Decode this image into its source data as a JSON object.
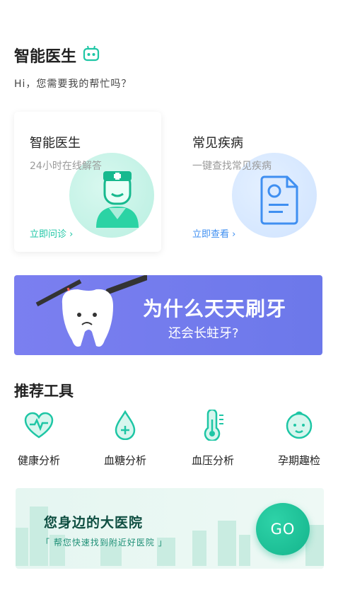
{
  "header": {
    "title": "智能医生",
    "subtitle": "Hi，您需要我的帮忙吗？",
    "robot_icon": "robot-icon"
  },
  "cards": [
    {
      "title": "智能医生",
      "desc": "24小时在线解答",
      "link": "立即问诊 ›",
      "icon": "doctor-icon"
    },
    {
      "title": "常见疾病",
      "desc": "一键查找常见疾病",
      "link": "立即查看 ›",
      "icon": "medical-record-icon"
    }
  ],
  "banner": {
    "line1": "为什么天天刷牙",
    "line2": "还会长蛀牙?"
  },
  "tools": {
    "title": "推荐工具",
    "items": [
      {
        "label": "健康分析",
        "icon": "heart-pulse-icon"
      },
      {
        "label": "血糖分析",
        "icon": "blood-drop-icon"
      },
      {
        "label": "血压分析",
        "icon": "thermometer-icon"
      },
      {
        "label": "孕期趣检",
        "icon": "baby-face-icon"
      }
    ]
  },
  "promo": {
    "title": "您身边的大医院",
    "subtitle": "「 帮您快速找到附近好医院 」",
    "button": "GO"
  },
  "colors": {
    "accent_green": "#1ec6a5",
    "accent_blue": "#3f8ff1",
    "banner_purple": "#7b7ff0"
  }
}
